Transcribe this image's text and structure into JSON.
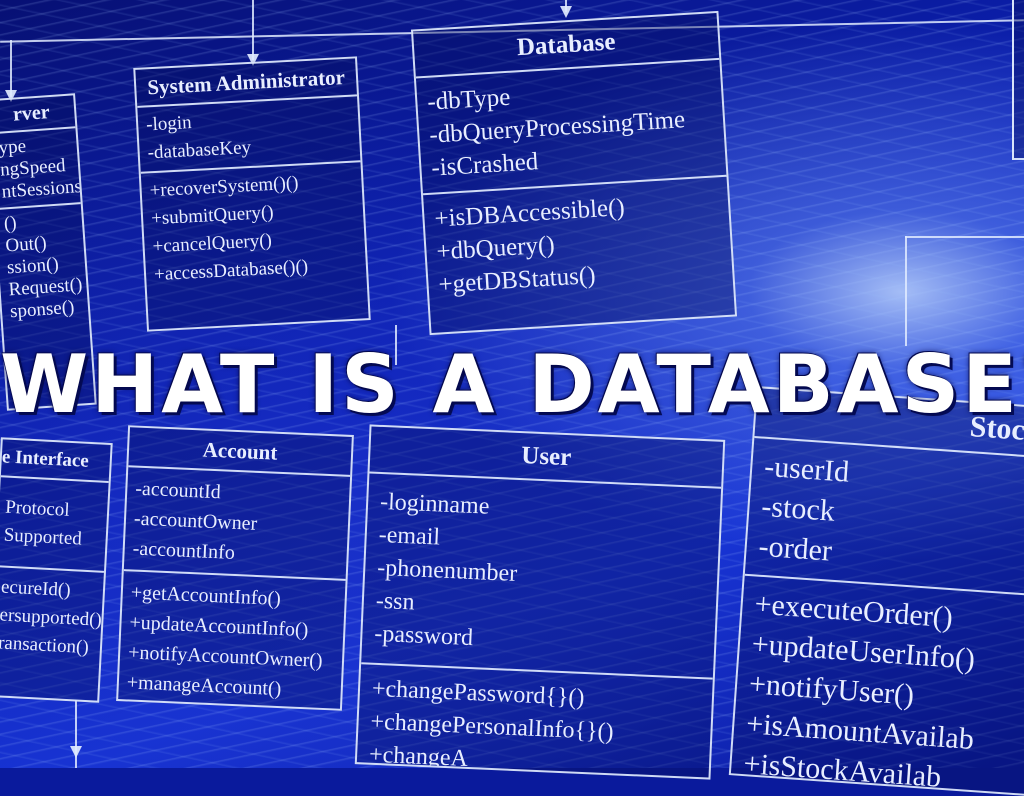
{
  "title": "WHAT IS A DATABASE?",
  "colors": {
    "background": "#0c22b8",
    "lines": "#e1ebff",
    "title": "#ffffff"
  },
  "diagram": {
    "server": {
      "name": "rver",
      "attributes": [
        "ype",
        "ngSpeed",
        "ntSessions"
      ],
      "methods": [
        "()",
        "Out()",
        "ssion()",
        "Request()",
        "sponse()"
      ]
    },
    "system_administrator": {
      "name": "System Administrator",
      "attributes": [
        "-login",
        "-databaseKey"
      ],
      "methods": [
        "+recoverSystem()()",
        "+submitQuery()",
        "+cancelQuery()",
        "+accessDatabase()()"
      ]
    },
    "database": {
      "name": "Database",
      "attributes": [
        "-dbType",
        "-dbQueryProcessingTime",
        "-isCrashed"
      ],
      "methods": [
        "+isDBAccessible()",
        "+dbQuery()",
        "+getDBStatus()"
      ]
    },
    "interface": {
      "name": "e Interface",
      "attributes": [
        "Protocol",
        "Supported"
      ],
      "methods": [
        "ecureId()",
        "ersupported()",
        "ransaction()"
      ]
    },
    "account": {
      "name": "Account",
      "attributes": [
        "-accountId",
        "-accountOwner",
        "-accountInfo"
      ],
      "methods": [
        "+getAccountInfo()",
        "+updateAccountInfo()",
        "+notifyAccountOwner()",
        "+manageAccount()"
      ]
    },
    "user": {
      "name": "User",
      "attributes": [
        "-loginname",
        "-email",
        "-phonenumber",
        "-ssn",
        "-password"
      ],
      "methods": [
        "+changePassword{}()",
        "+changePersonalInfo{}()",
        "+changeA"
      ]
    },
    "stock": {
      "name": "Stock",
      "attributes": [
        "-userId",
        "-stock",
        "-order"
      ],
      "methods": [
        "+executeOrder()",
        "+updateUserInfo()",
        "+notifyUser()",
        "+isAmountAvailab",
        "+isStockAvailab"
      ]
    }
  }
}
